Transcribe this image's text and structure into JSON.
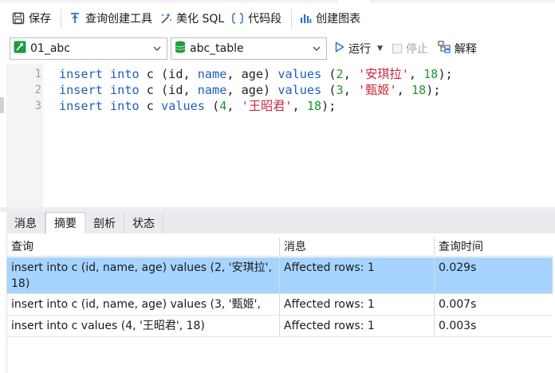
{
  "toolbar": {
    "save": "保存",
    "query_builder": "查询创建工具",
    "beautify_sql": "美化 SQL",
    "snippet": "代码段",
    "create_chart": "创建图表"
  },
  "connection": {
    "selected": "01_abc",
    "table": "abc_table",
    "run": "运行",
    "stop": "停止",
    "explain": "解释"
  },
  "editor": {
    "lines": [
      {
        "number": "1",
        "tokens": [
          {
            "t": "kw",
            "v": "insert"
          },
          {
            "t": "plain",
            "v": " "
          },
          {
            "t": "kw",
            "v": "into"
          },
          {
            "t": "plain",
            "v": " c (id, "
          },
          {
            "t": "kw",
            "v": "name"
          },
          {
            "t": "plain",
            "v": ", age) "
          },
          {
            "t": "kw",
            "v": "values"
          },
          {
            "t": "plain",
            "v": " ("
          },
          {
            "t": "num",
            "v": "2"
          },
          {
            "t": "plain",
            "v": ", "
          },
          {
            "t": "str",
            "v": "'安琪拉'"
          },
          {
            "t": "plain",
            "v": ", "
          },
          {
            "t": "num",
            "v": "18"
          },
          {
            "t": "plain",
            "v": ");"
          }
        ]
      },
      {
        "number": "2",
        "tokens": [
          {
            "t": "kw",
            "v": "insert"
          },
          {
            "t": "plain",
            "v": " "
          },
          {
            "t": "kw",
            "v": "into"
          },
          {
            "t": "plain",
            "v": " c (id, "
          },
          {
            "t": "kw",
            "v": "name"
          },
          {
            "t": "plain",
            "v": ", age) "
          },
          {
            "t": "kw",
            "v": "values"
          },
          {
            "t": "plain",
            "v": " ("
          },
          {
            "t": "num",
            "v": "3"
          },
          {
            "t": "plain",
            "v": ", "
          },
          {
            "t": "str",
            "v": "'甄姬'"
          },
          {
            "t": "plain",
            "v": ", "
          },
          {
            "t": "num",
            "v": "18"
          },
          {
            "t": "plain",
            "v": ");"
          }
        ]
      },
      {
        "number": "3",
        "tokens": [
          {
            "t": "kw",
            "v": "insert"
          },
          {
            "t": "plain",
            "v": " "
          },
          {
            "t": "kw",
            "v": "into"
          },
          {
            "t": "plain",
            "v": " c "
          },
          {
            "t": "kw",
            "v": "values"
          },
          {
            "t": "plain",
            "v": " ("
          },
          {
            "t": "num",
            "v": "4"
          },
          {
            "t": "plain",
            "v": ", "
          },
          {
            "t": "str",
            "v": "'王昭君'"
          },
          {
            "t": "plain",
            "v": ", "
          },
          {
            "t": "num",
            "v": "18"
          },
          {
            "t": "plain",
            "v": ");"
          }
        ]
      }
    ]
  },
  "result_tabs": [
    "消息",
    "摘要",
    "剖析",
    "状态"
  ],
  "active_result_tab": "摘要",
  "results": {
    "columns": [
      "查询",
      "消息",
      "查询时间"
    ],
    "rows": [
      {
        "query": "insert into c (id, name, age) values (2, '安琪拉',",
        "query2": "18)",
        "message": "Affected rows: 1",
        "time": "0.029s"
      },
      {
        "query": "insert into c (id, name, age) values (3, '甄姬',",
        "message": "Affected rows: 1",
        "time": "0.007s"
      },
      {
        "query": "insert into c values (4, '王昭君', 18)",
        "message": "Affected rows: 1",
        "time": "0.003s"
      }
    ]
  },
  "colors": {
    "keyword": "#1f5fbf",
    "string": "#d0243d",
    "number": "#1b9b2e",
    "selected_row": "#a6d4ff"
  }
}
